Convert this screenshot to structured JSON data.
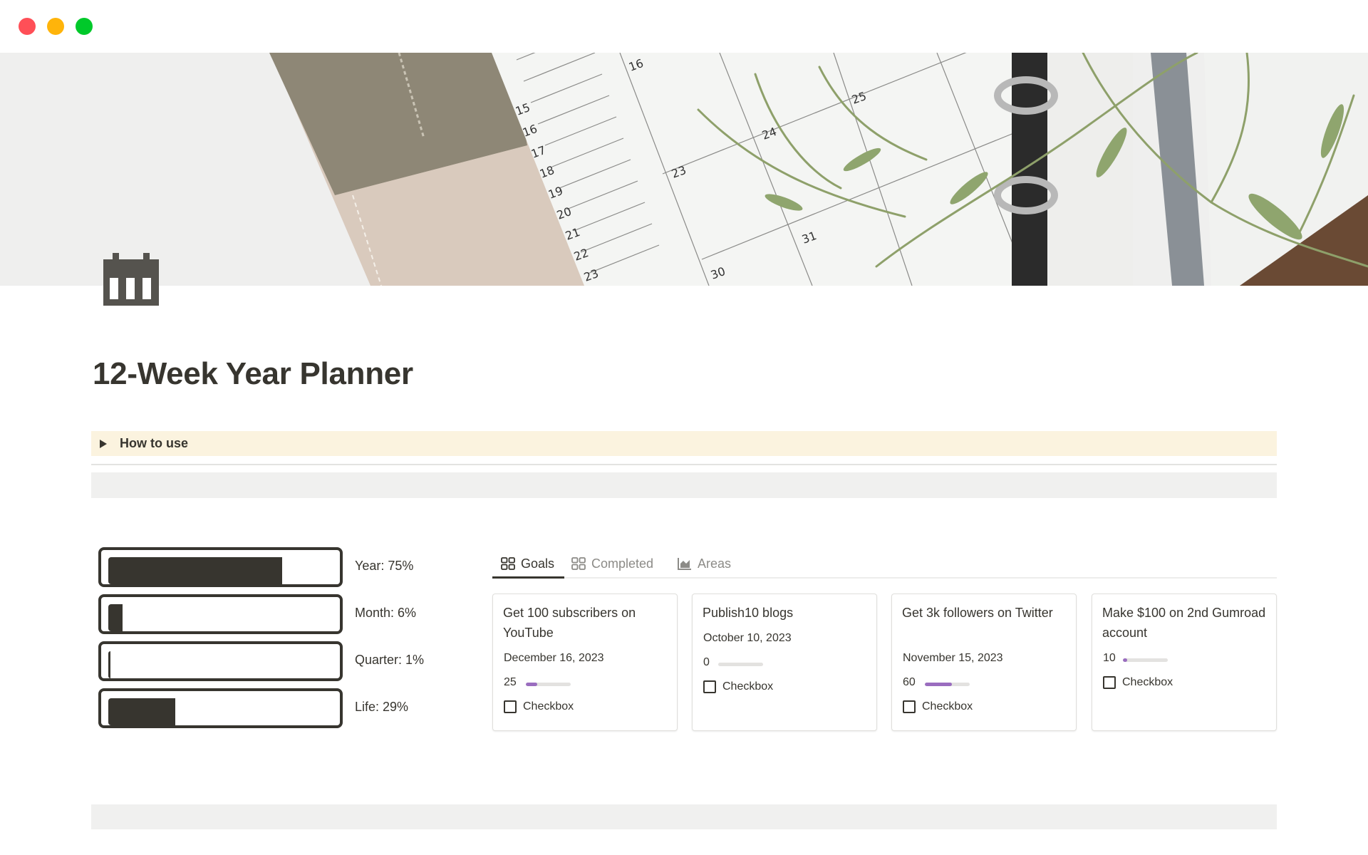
{
  "window": {
    "controls": [
      "close",
      "minimize",
      "maximize"
    ]
  },
  "page": {
    "icon": "calendar-icon",
    "title": "12-Week Year Planner"
  },
  "toggle": {
    "label": "How to use",
    "expanded": false
  },
  "progress": [
    {
      "label": "Year: 75%",
      "percent": 75
    },
    {
      "label": "Month: 6%",
      "percent": 6
    },
    {
      "label": "Quarter: 1%",
      "percent": 1
    },
    {
      "label": "Life: 29%",
      "percent": 29
    }
  ],
  "tabs": [
    {
      "label": "Goals",
      "icon": "gallery-icon",
      "active": true
    },
    {
      "label": "Completed",
      "icon": "gallery-icon",
      "active": false
    },
    {
      "label": "Areas",
      "icon": "area-chart-icon",
      "active": false
    }
  ],
  "accent_colors": {
    "progress_fill": "#37352f",
    "card_bar_fill": "#9a6dbf",
    "toggle_bg": "#fbf3df"
  },
  "cards": [
    {
      "title": "Get 100 subscribers on YouTube",
      "date": "December 16, 2023",
      "progress": 25,
      "checkbox_label": "Checkbox",
      "checked": false
    },
    {
      "title": "Publish10 blogs",
      "date": "October 10, 2023",
      "progress": 0,
      "checkbox_label": "Checkbox",
      "checked": false
    },
    {
      "title": "Get 3k followers on Twitter",
      "date": "November 15, 2023",
      "progress": 60,
      "checkbox_label": "Checkbox",
      "checked": false
    },
    {
      "title": "Make $100 on 2nd Gumroad account",
      "date": "",
      "progress": 10,
      "checkbox_label": "Checkbox",
      "checked": false
    }
  ]
}
